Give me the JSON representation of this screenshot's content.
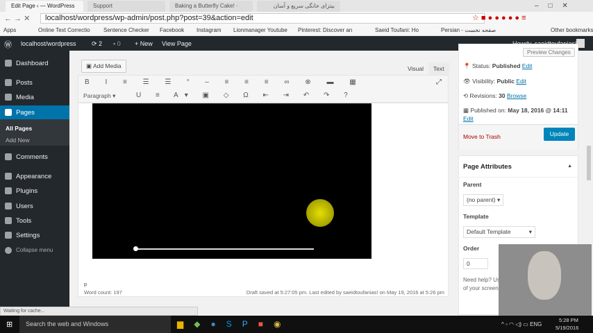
{
  "browser": {
    "tabs": [
      "Edit Page ‹ — WordPress",
      "Support",
      "Baking a Butterfly Cake! ·",
      "بیتزای خانگی سریع و آسان"
    ],
    "url": "localhost/wordpress/wp-admin/post.php?post=39&action=edit",
    "bookmarks": [
      "Apps",
      "Online Text Correctio",
      "Sentence Checker",
      "Facebook",
      "Instagram",
      "Lionmanager Youtube",
      "Pinterest: Discover an",
      "Saeid Toufani: Ho",
      "Persian - صفحه نخست",
      "Other bookmarks"
    ],
    "status": "Waiting for cache..."
  },
  "adminbar": {
    "site": "localhost/wordpress",
    "updates": "2",
    "comments": "0",
    "new": "New",
    "view": "View Page",
    "howdy": "Howdy, saeidtoufanias!"
  },
  "sidebar": {
    "items": [
      "Dashboard",
      "Posts",
      "Media",
      "Pages",
      "Comments",
      "Appearance",
      "Plugins",
      "Users",
      "Tools",
      "Settings",
      "Collapse menu"
    ],
    "sub": [
      "All Pages",
      "Add New"
    ]
  },
  "editor": {
    "add_media": "Add Media",
    "visual": "Visual",
    "text": "Text",
    "format": "Paragraph",
    "path": "p",
    "word_count": "Word count: 197",
    "draft": "Draft saved at 5:27:05 pm. Last edited by saeidtoufanias! on May 19, 2016 at 5:26 pm"
  },
  "publish": {
    "preview": "Preview Changes",
    "status_label": "Status:",
    "status": "Published",
    "visibility_label": "Visibility:",
    "visibility": "Public",
    "revisions_label": "Revisions:",
    "revisions": "30",
    "browse": "Browse",
    "published_label": "Published on:",
    "published": "May 18, 2016 @ 14:11",
    "edit": "Edit",
    "trash": "Move to Trash",
    "update": "Update"
  },
  "attributes": {
    "title": "Page Attributes",
    "parent_label": "Parent",
    "parent": "(no parent)",
    "template_label": "Template",
    "template": "Default Template",
    "order_label": "Order",
    "order": "0",
    "help": "Need help? Use the Help tab in the upper right of your screen."
  },
  "taskbar": {
    "search": "Search the web and Windows",
    "lang": "ENG",
    "time": "5:28 PM",
    "date": "5/19/2016"
  },
  "colors": {
    "accent": "#0073aa",
    "adminbar": "#23282d",
    "trash": "#a00"
  }
}
